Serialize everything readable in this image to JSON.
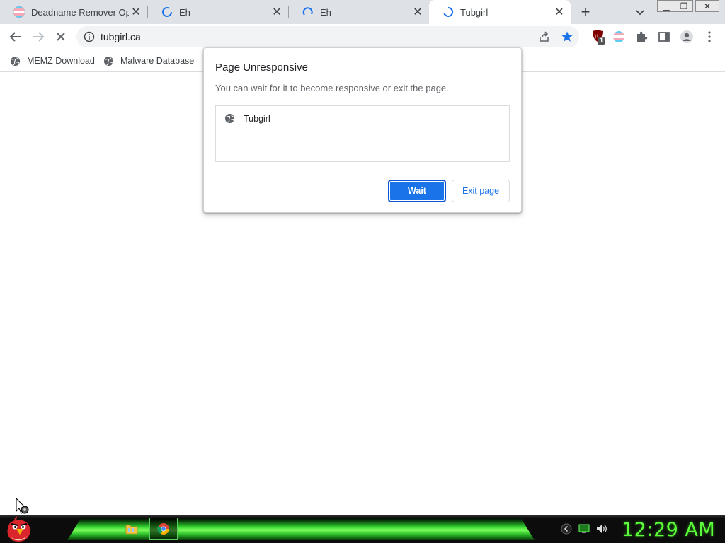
{
  "tabs": [
    {
      "title": "Deadname Remover Opti",
      "active": false
    },
    {
      "title": "Eh",
      "active": false
    },
    {
      "title": "Eh",
      "active": false
    },
    {
      "title": "Tubgirl",
      "active": true
    }
  ],
  "tab_close_glyph": "✕",
  "new_tab_glyph": "+",
  "window_controls": {
    "minimize": "▁",
    "maximize": "❐",
    "close": "✕"
  },
  "toolbar": {
    "url": "tubgirl.ca"
  },
  "bookmarks": [
    {
      "label": "MEMZ Download"
    },
    {
      "label": "Malware Database"
    }
  ],
  "extension_badge": "1",
  "dialog": {
    "title": "Page Unresponsive",
    "message": "You can wait for it to become responsive or exit the page.",
    "pages": [
      "Tubgirl"
    ],
    "wait_label": "Wait",
    "exit_label": "Exit page"
  },
  "taskbar": {
    "clock": "12:29 AM"
  },
  "colors": {
    "accent": "#1a73e8",
    "clock": "#5cff3a",
    "taskbar_green": "#2ecc2e"
  }
}
